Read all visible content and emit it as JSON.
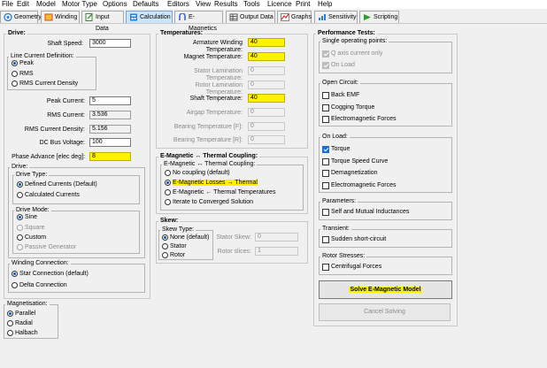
{
  "menu": [
    "File",
    "Edit",
    "Model",
    "Motor Type",
    "Options",
    "Defaults",
    "Editors",
    "View",
    "Results",
    "Tools",
    "Licence",
    "Print",
    "Help"
  ],
  "tabs": [
    {
      "label": "Geometry",
      "icon": "geometry-icon",
      "color": "#2a7fd4"
    },
    {
      "label": "Winding",
      "icon": "winding-icon",
      "color": "#d94a2a"
    },
    {
      "label": "Input Data",
      "icon": "input-data-icon",
      "color": "#3a8a3a"
    },
    {
      "label": "Calculation",
      "icon": "calculation-icon",
      "color": "#2a7fd4"
    },
    {
      "label": "E-Magnetics",
      "icon": "emagnetics-icon",
      "color": "#3a6ad4"
    },
    {
      "label": "Output Data",
      "icon": "output-data-icon",
      "color": "#555555"
    },
    {
      "label": "Graphs",
      "icon": "graphs-icon",
      "color": "#d42a2a"
    },
    {
      "label": "Sensitivity",
      "icon": "sensitivity-icon",
      "color": "#2a7fd4"
    },
    {
      "label": "Scripting",
      "icon": "scripting-icon",
      "color": "#2aa02a"
    }
  ],
  "drive": {
    "title": "Drive:",
    "shaft_speed": {
      "label": "Shaft Speed:",
      "value": "3000"
    },
    "lcd": {
      "title": "Line Current Definition:",
      "options": [
        "Peak",
        "RMS",
        "RMS Current Density"
      ],
      "selected": 0
    },
    "peak_current": {
      "label": "Peak Current:",
      "value": "5"
    },
    "rms_current": {
      "label": "RMS Current:",
      "value": "3.536"
    },
    "rms_density": {
      "label": "RMS Current Density:",
      "value": "5.156"
    },
    "dc_bus": {
      "label": "DC Bus Voltage:",
      "value": "100"
    },
    "phase_adv": {
      "label": "Phase Advance [elec deg]:",
      "value": "8"
    },
    "drive_group": {
      "title": "Drive:"
    },
    "drive_type": {
      "title": "Drive Type:",
      "options": [
        "Defined Currents (Default)",
        "Calculated Currents"
      ],
      "selected": 0
    },
    "drive_mode": {
      "title": "Drive Mode:",
      "options": [
        "Sine",
        "Square",
        "Custom",
        "Passive Generator"
      ],
      "selected": 0
    },
    "winding_conn": {
      "title": "Winding Connection:",
      "options": [
        "Star Connection (default)",
        "Delta Connection"
      ],
      "selected": 0
    },
    "magnetisation": {
      "title": "Magnetisation:",
      "options": [
        "Parallel",
        "Radial",
        "Halbach"
      ],
      "selected": 0
    }
  },
  "temperatures": {
    "title": "Temperatures:",
    "rows": [
      {
        "label": "Armature Winding Temperature:",
        "value": "40",
        "state": "hl"
      },
      {
        "label": "Magnet Temperature:",
        "value": "40",
        "state": "hl"
      },
      {
        "label": "Stator Lamination Temperature:",
        "value": "0",
        "state": "dis"
      },
      {
        "label": "Rotor Lamination Temperature:",
        "value": "0",
        "state": "dis"
      },
      {
        "label": "Shaft Temperature:",
        "value": "40",
        "state": "hl"
      },
      {
        "label": "Airgap Temperature:",
        "value": "0",
        "state": "dis"
      },
      {
        "label": "Bearing Temperature [F]:",
        "value": "0",
        "state": "dis"
      },
      {
        "label": "Bearing Temperature [R]:",
        "value": "0",
        "state": "dis"
      }
    ]
  },
  "coupling": {
    "title": "E-Magnetic ↔ Thermal Coupling:",
    "sub": "E-Magnetic ↔ Thermal Coupling:",
    "options": [
      "No coupling (default)",
      "E-Magnetic Losses → Thermal",
      "E-Magnetic ← Thermal Temperatures",
      "Iterate to Converged Solution"
    ],
    "selected": 1
  },
  "skew": {
    "title": "Skew:",
    "type_title": "Skew Type:",
    "options": [
      "None (default)",
      "Stator",
      "Rotor"
    ],
    "selected": 0,
    "stator_skew": {
      "label": "Stator Skew:",
      "value": "0"
    },
    "rotor_slices": {
      "label": "Rotor slices:",
      "value": "1"
    }
  },
  "perf": {
    "title": "Performance Tests:",
    "single": {
      "title": "Single operating points:",
      "items": [
        {
          "label": "Q axis current only",
          "checked": true,
          "disabled": true
        },
        {
          "label": "On Load",
          "checked": true,
          "disabled": true
        }
      ]
    },
    "open": {
      "title": "Open Circuit:",
      "items": [
        {
          "label": "Back EMF",
          "checked": false
        },
        {
          "label": "Cogging Torque",
          "checked": false
        },
        {
          "label": "Electromagnetic Forces",
          "checked": false
        }
      ]
    },
    "load": {
      "title": "On Load:",
      "items": [
        {
          "label": "Torque",
          "checked": true
        },
        {
          "label": "Torque Speed Curve",
          "checked": false
        },
        {
          "label": "Demagnetization",
          "checked": false
        },
        {
          "label": "Electromagnetic Forces",
          "checked": false
        }
      ]
    },
    "params": {
      "title": "Parameters:",
      "items": [
        {
          "label": "Self and Mutual Inductances",
          "checked": false
        }
      ]
    },
    "transient": {
      "title": "Transient:",
      "items": [
        {
          "label": "Sudden short-circuit",
          "checked": false
        }
      ]
    },
    "rotor": {
      "title": "Rotor Stresses:",
      "items": [
        {
          "label": "Centrifugal Forces",
          "checked": false
        }
      ]
    },
    "solve_btn": "Solve E-Magnetic Model",
    "cancel_btn": "Cancel Solving"
  }
}
